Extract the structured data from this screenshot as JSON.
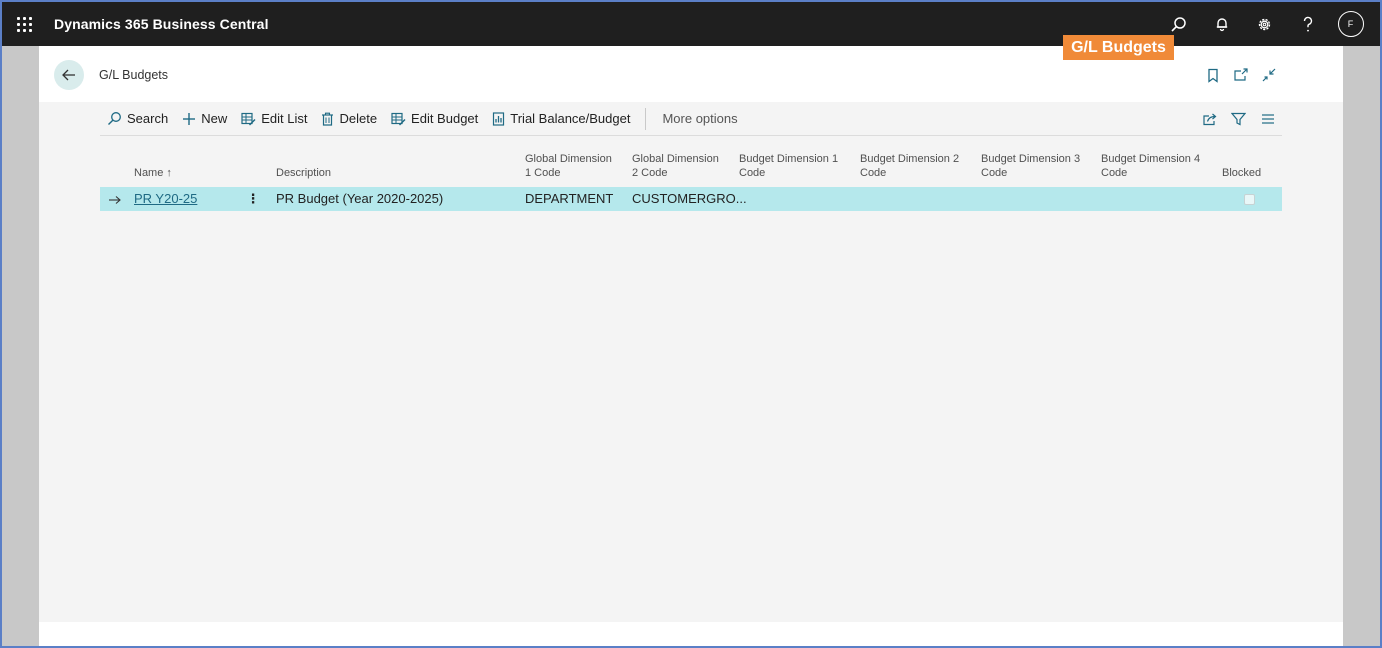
{
  "topbar": {
    "app_title": "Dynamics 365 Business Central",
    "icons": [
      "waffle-icon",
      "search-icon",
      "bell-icon",
      "gear-icon",
      "help-icon"
    ],
    "avatar_initial": "F"
  },
  "callout": {
    "label": "G/L Budgets"
  },
  "header": {
    "breadcrumb": "G/L Budgets",
    "icons": [
      "bookmark-icon",
      "open-new-window-icon",
      "collapse-icon"
    ]
  },
  "actions": {
    "search": "Search",
    "new": "New",
    "edit_list": "Edit List",
    "delete": "Delete",
    "edit_budget": "Edit Budget",
    "trial_balance": "Trial Balance/Budget",
    "more_options": "More options"
  },
  "table": {
    "columns": {
      "name": "Name",
      "description": "Description",
      "global_dim_1_l1": "Global Dimension",
      "global_dim_1_l2": "1 Code",
      "global_dim_2_l1": "Global Dimension",
      "global_dim_2_l2": "2 Code",
      "budget_dim_1_l1": "Budget Dimension 1",
      "budget_dim_1_l2": "Code",
      "budget_dim_2_l1": "Budget Dimension 2",
      "budget_dim_2_l2": "Code",
      "budget_dim_3_l1": "Budget Dimension 3",
      "budget_dim_3_l2": "Code",
      "budget_dim_4_l1": "Budget Dimension 4",
      "budget_dim_4_l2": "Code",
      "blocked": "Blocked"
    },
    "sort_indicator": "↑",
    "rows": [
      {
        "name": "PR Y20-25",
        "description": "PR Budget (Year 2020-2025)",
        "global_dim_1": "DEPARTMENT",
        "global_dim_2": "CUSTOMERGRO...",
        "budget_dim_1": "",
        "budget_dim_2": "",
        "budget_dim_3": "",
        "budget_dim_4": "",
        "blocked": false
      }
    ]
  },
  "colors": {
    "topbar_bg": "#1f1f1f",
    "callout_bg": "#f08a38",
    "selected_row_bg": "#b5e8ec",
    "accent": "#1f6a84",
    "page_bg": "#f4f4f4"
  }
}
